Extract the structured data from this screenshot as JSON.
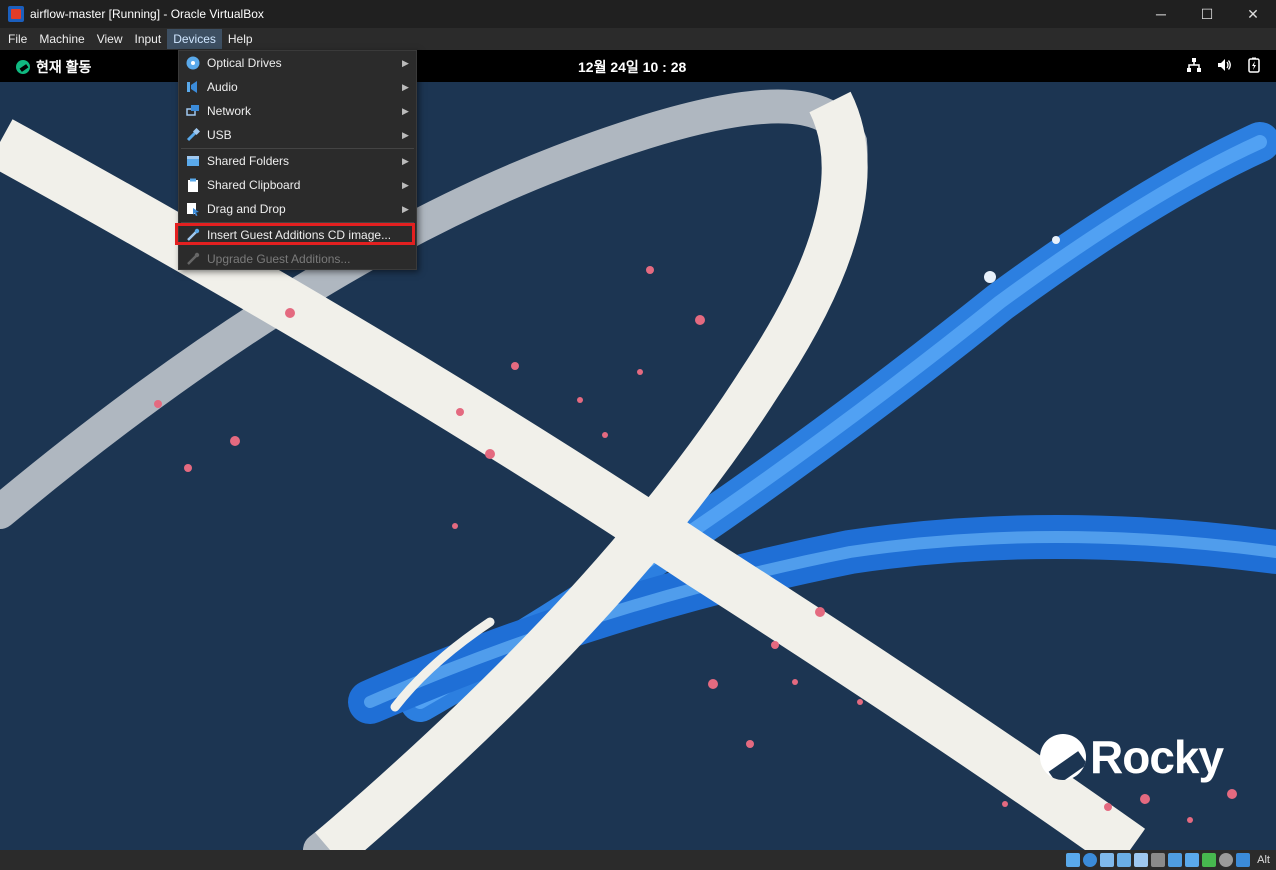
{
  "window": {
    "title": "airflow-master [Running] - Oracle VirtualBox",
    "controls": {
      "minimize": "─",
      "maximize": "☐",
      "close": "✕"
    }
  },
  "menubar": {
    "items": [
      {
        "label": "File"
      },
      {
        "label": "Machine"
      },
      {
        "label": "View"
      },
      {
        "label": "Input"
      },
      {
        "label": "Devices",
        "active": true
      },
      {
        "label": "Help"
      }
    ]
  },
  "devices_menu": {
    "items": [
      {
        "label": "Optical Drives",
        "icon": "optical-drive-icon",
        "submenu": true
      },
      {
        "label": "Audio",
        "icon": "audio-icon",
        "submenu": true
      },
      {
        "label": "Network",
        "icon": "network-icon",
        "submenu": true
      },
      {
        "label": "USB",
        "icon": "usb-icon",
        "submenu": true
      },
      {
        "label": "Shared Folders",
        "icon": "shared-folders-icon",
        "submenu": true
      },
      {
        "label": "Shared Clipboard",
        "icon": "shared-clipboard-icon",
        "submenu": true
      },
      {
        "label": "Drag and Drop",
        "icon": "drag-and-drop-icon",
        "submenu": true
      },
      {
        "label": "Insert Guest Additions CD image...",
        "icon": "guest-additions-icon",
        "submenu": false,
        "highlighted": true
      },
      {
        "label": "Upgrade Guest Additions...",
        "icon": "upgrade-guest-additions-icon",
        "submenu": false,
        "disabled": true
      }
    ]
  },
  "guest_topbar": {
    "activities": "현재 활동",
    "clock": "12월 24일  10 : 28",
    "tray": [
      "network-icon",
      "volume-icon",
      "battery-icon"
    ]
  },
  "wallpaper": {
    "logo_text": "Rocky"
  },
  "statusbar": {
    "key_indicator": "Alt",
    "icons": [
      "hard-disk-icon",
      "optical-drive-icon",
      "audio-icon",
      "network-icon",
      "usb-icon",
      "shared-folders-icon",
      "display-icon",
      "recording-icon",
      "cpu-icon",
      "mouse-icon",
      "host-key-icon"
    ]
  },
  "colors": {
    "desktop_bg": "#1c3552",
    "highlight_border": "#e32020",
    "menu_bg": "#2b2b2b"
  }
}
